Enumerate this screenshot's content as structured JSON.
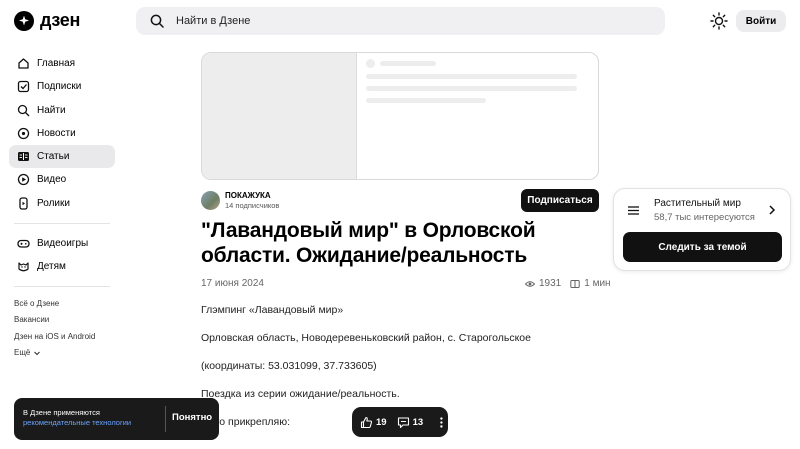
{
  "header": {
    "logo_text": "дзен",
    "search_placeholder": "Найти в Дзене",
    "login_label": "Войти"
  },
  "sidebar": {
    "items": [
      {
        "label": "Главная",
        "icon": "home-icon"
      },
      {
        "label": "Подписки",
        "icon": "subscriptions-icon"
      },
      {
        "label": "Найти",
        "icon": "search-icon"
      },
      {
        "label": "Новости",
        "icon": "news-icon"
      },
      {
        "label": "Статьи",
        "icon": "articles-icon",
        "active": true
      },
      {
        "label": "Видео",
        "icon": "video-icon"
      },
      {
        "label": "Ролики",
        "icon": "shorts-icon"
      }
    ],
    "extra_items": [
      {
        "label": "Видеоигры",
        "icon": "gamepad-icon"
      },
      {
        "label": "Детям",
        "icon": "kids-icon"
      }
    ],
    "footer_links": [
      "Всё о Дзене",
      "Вакансии",
      "Дзен на iOS и Android",
      "Ещё"
    ]
  },
  "author": {
    "name": "ПОКАЖУКА",
    "subscribers": "14 подписчиков",
    "subscribe_label": "Подписаться"
  },
  "article": {
    "title": "\"Лавандовый мир\" в Орловской области. Ожидание/реальность",
    "date": "17 июня 2024",
    "views": "1931",
    "read_time": "1 мин",
    "paragraphs": [
      "Глэмпинг «Лавандовый мир»",
      "Орловская область, Новодеревеньковский район, с. Старогольское",
      "(координаты: 53.031099, 37.733605)",
      "Поездка из серии ожидание/реальность.",
      "Фото прикрепляю:"
    ]
  },
  "topic_card": {
    "name": "Растительный мир",
    "count": "58,7 тыс интересуются",
    "follow_label": "Следить за темой"
  },
  "cookie_banner": {
    "text": "В Дзене применяются",
    "link": "рекомендательные технологии",
    "ok_label": "Понятно"
  },
  "action_bar": {
    "likes": "19",
    "comments": "13"
  }
}
